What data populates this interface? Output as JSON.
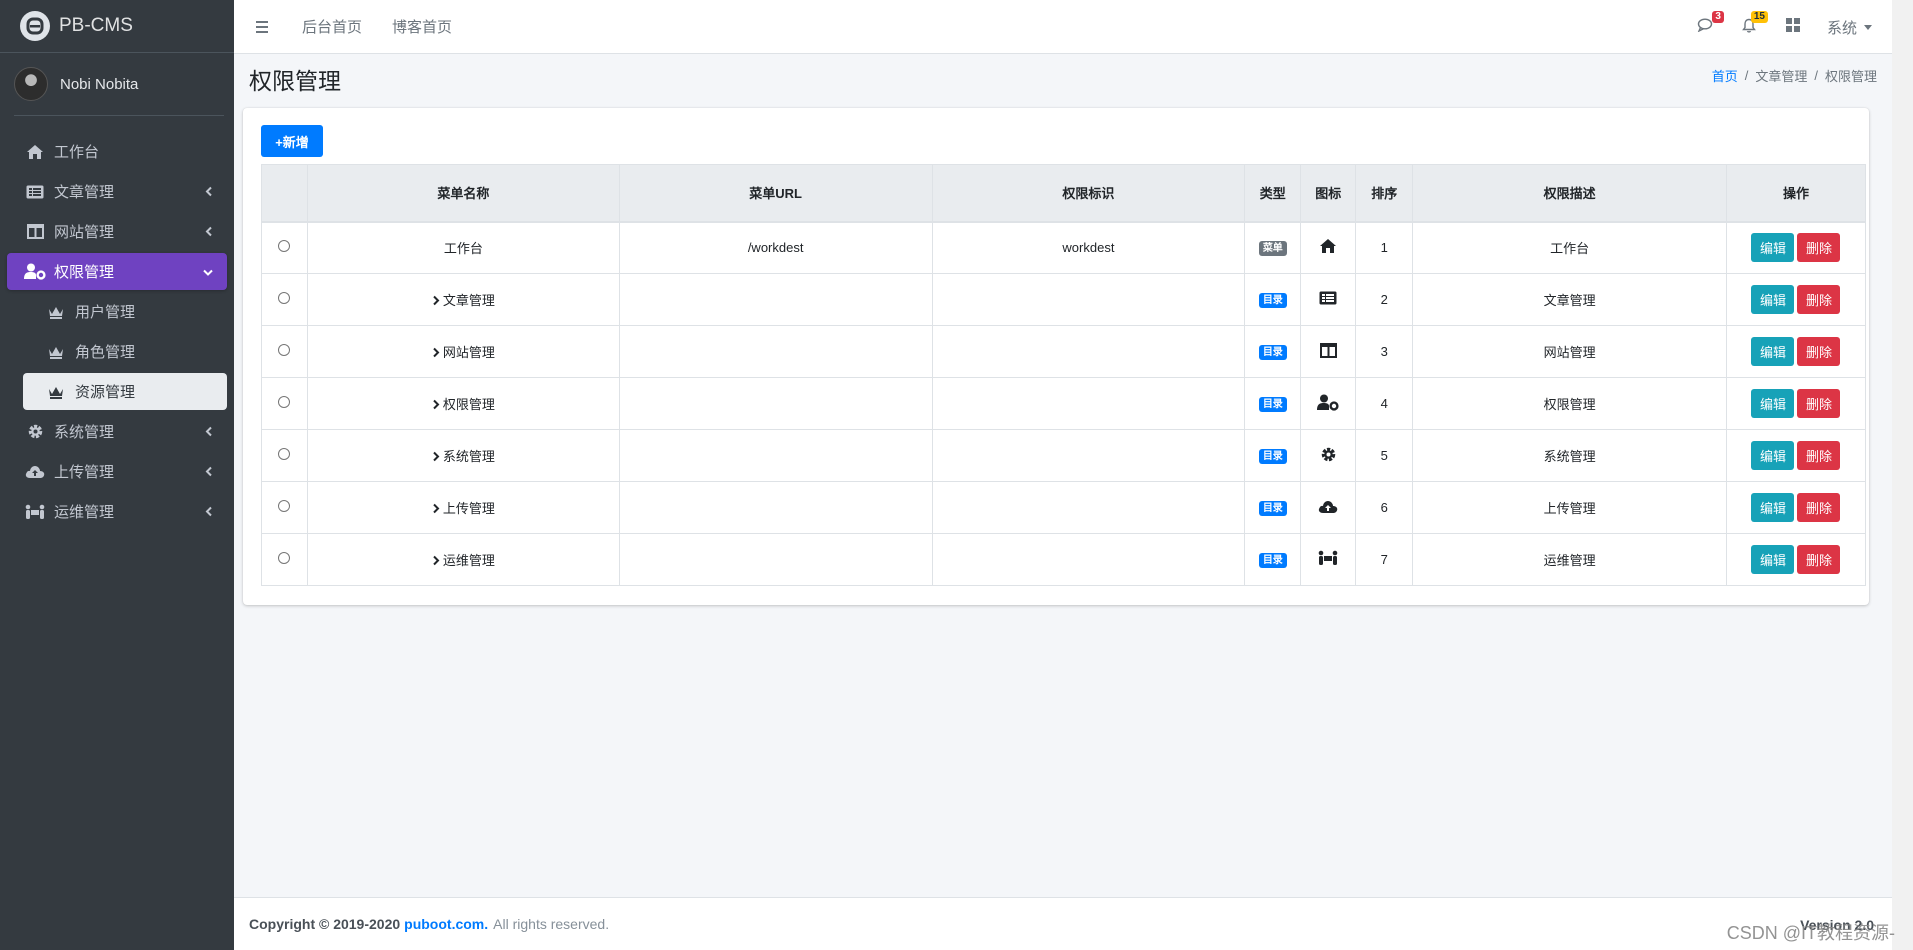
{
  "brand": {
    "title": "PB-CMS"
  },
  "user": {
    "name": "Nobi Nobita"
  },
  "sidebar": {
    "items": [
      {
        "label": "工作台",
        "icon": "home-icon"
      },
      {
        "label": "文章管理",
        "icon": "list-alt-icon"
      },
      {
        "label": "网站管理",
        "icon": "columns-icon"
      },
      {
        "label": "权限管理",
        "icon": "user-cog-icon"
      },
      {
        "label": "系统管理",
        "icon": "gear-icon"
      },
      {
        "label": "上传管理",
        "icon": "cloud-upload-icon"
      },
      {
        "label": "运维管理",
        "icon": "people-carry-icon"
      }
    ],
    "sub_items": [
      {
        "label": "用户管理",
        "icon": "chess-queen-icon"
      },
      {
        "label": "角色管理",
        "icon": "chess-queen-icon"
      },
      {
        "label": "资源管理",
        "icon": "chess-queen-icon"
      }
    ],
    "active_color": "#6f42c1"
  },
  "topbar": {
    "links": [
      "后台首页",
      "博客首页"
    ],
    "messages_count": "3",
    "notifications_count": "15",
    "system_menu": "系统"
  },
  "page": {
    "title": "权限管理",
    "breadcrumb": [
      "首页",
      "文章管理",
      "权限管理"
    ]
  },
  "toolbar": {
    "add_label": "+新增"
  },
  "table": {
    "headers": [
      "菜单名称",
      "菜单URL",
      "权限标识",
      "类型",
      "图标",
      "排序",
      "权限描述",
      "操作"
    ],
    "edit_label": "编辑",
    "delete_label": "删除",
    "rows": [
      {
        "name": "工作台",
        "url": "/workdest",
        "perm": "workdest",
        "type": "菜单",
        "type_kind": "menu",
        "icon": "home-icon",
        "sort": "1",
        "desc": "工作台",
        "expandable": false
      },
      {
        "name": "文章管理",
        "url": "",
        "perm": "",
        "type": "目录",
        "type_kind": "dir",
        "icon": "list-alt-icon",
        "sort": "2",
        "desc": "文章管理",
        "expandable": true
      },
      {
        "name": "网站管理",
        "url": "",
        "perm": "",
        "type": "目录",
        "type_kind": "dir",
        "icon": "columns-icon",
        "sort": "3",
        "desc": "网站管理",
        "expandable": true
      },
      {
        "name": "权限管理",
        "url": "",
        "perm": "",
        "type": "目录",
        "type_kind": "dir",
        "icon": "user-cog-icon",
        "sort": "4",
        "desc": "权限管理",
        "expandable": true
      },
      {
        "name": "系统管理",
        "url": "",
        "perm": "",
        "type": "目录",
        "type_kind": "dir",
        "icon": "gear-icon",
        "sort": "5",
        "desc": "系统管理",
        "expandable": true
      },
      {
        "name": "上传管理",
        "url": "",
        "perm": "",
        "type": "目录",
        "type_kind": "dir",
        "icon": "cloud-upload-icon",
        "sort": "6",
        "desc": "上传管理",
        "expandable": true
      },
      {
        "name": "运维管理",
        "url": "",
        "perm": "",
        "type": "目录",
        "type_kind": "dir",
        "icon": "people-carry-icon",
        "sort": "7",
        "desc": "运维管理",
        "expandable": true
      }
    ]
  },
  "footer": {
    "copyright": "Copyright © 2019-2020",
    "link": "puboot.com.",
    "rights": "All rights reserved.",
    "version": "Version 2.0"
  },
  "watermark": "CSDN @IT教程资源-"
}
